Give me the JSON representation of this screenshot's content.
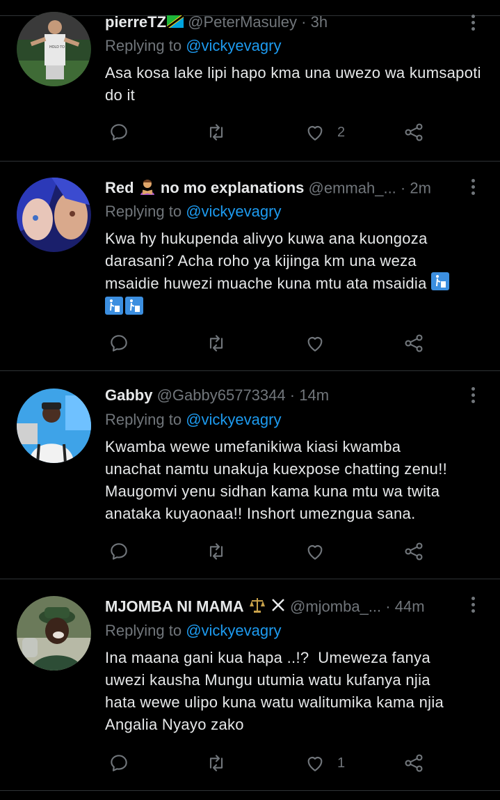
{
  "replies_label": "Replying to",
  "tweets": [
    {
      "name": "pierreTZ",
      "name_emoji": "tz-flag",
      "handle": "@PeterMasuley",
      "time": "3h",
      "reply_to": "@vickyevagry",
      "text": "Asa kosa lake lipi hapo kma una uwezo wa kumsapoti do it",
      "like_count": "2",
      "avatar": "player-photo"
    },
    {
      "name": "Red",
      "name_suffix": "no mo explanations",
      "name_emoji": "person-crossing-arms",
      "handle": "@emmah_...",
      "time": "2m",
      "reply_to": "@vickyevagry",
      "text_lines": [
        "Kwa hy hukupenda alivyo kuwa ana kuongoza",
        "darasani? Acha roho ya kijinga km una weza",
        "msaidie huwezi muache kuna mtu ata msaidia"
      ],
      "trailing_emoji": "litter-in-bin",
      "like_count": "",
      "avatar": "anime-art"
    },
    {
      "name": "Gabby",
      "handle": "@Gabby65773344",
      "time": "14m",
      "reply_to": "@vickyevagry",
      "text_lines": [
        "Kwamba wewe umefanikiwa kiasi kwamba",
        "unachat namtu unakuja kuexpose chatting zenu!!",
        "Maugomvi yenu sidhan kama kuna mtu wa twita",
        "anataka kuyaonaa!! Inshort umezngua sana."
      ],
      "like_count": "",
      "avatar": "man-cap-photo"
    },
    {
      "name": "MJOMBA NI MAMA",
      "name_emoji": "scales-and-x",
      "handle": "@mjomba_...",
      "time": "44m",
      "reply_to": "@vickyevagry",
      "text_lines": [
        "Ina maana gani kua hapa ..!?  Umeweza fanya",
        "uwezi kausha Mungu utumia watu kufanya njia",
        "hata wewe ulipo kuna watu walitumika kama njia",
        "Angalia Nyayo zako"
      ],
      "like_count": "1",
      "avatar": "man-hat-photo"
    }
  ],
  "colors": {
    "background": "#000000",
    "text": "#e7e9ea",
    "muted": "#71767b",
    "link": "#1d9bf0",
    "divider": "#2f3336"
  }
}
